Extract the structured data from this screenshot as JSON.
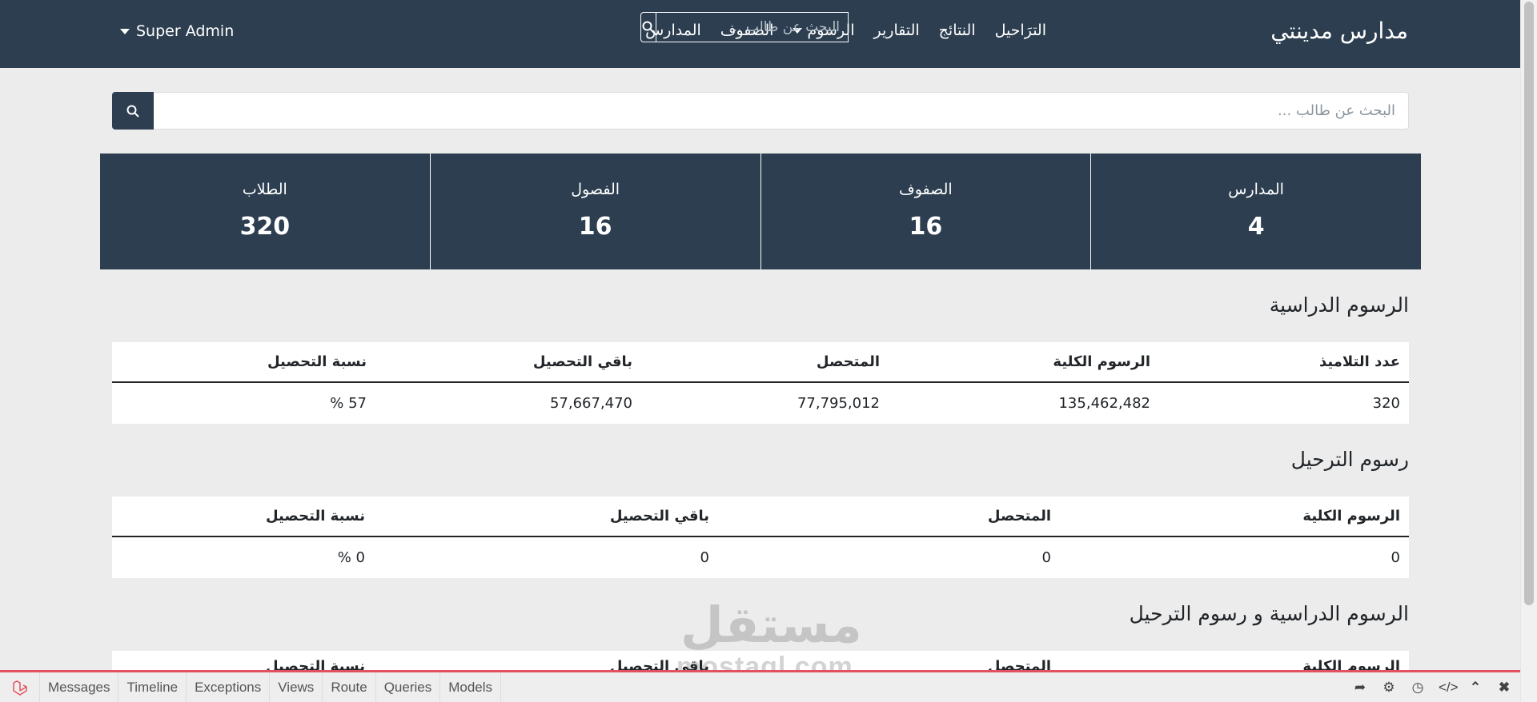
{
  "navbar": {
    "brand": "مدارس مدينتي",
    "links": [
      {
        "label": "المدارس",
        "dropdown": false
      },
      {
        "label": "الصفوف",
        "dropdown": false
      },
      {
        "label": "الرسوم",
        "dropdown": true
      },
      {
        "label": "التقارير",
        "dropdown": false
      },
      {
        "label": "النتائج",
        "dropdown": false
      },
      {
        "label": "الترَاحيل",
        "dropdown": false
      }
    ],
    "search_placeholder": "البحث عن طالب ...",
    "user": "Super Admin"
  },
  "main_search": {
    "placeholder": "البحث عن طالب ..."
  },
  "stats": [
    {
      "label": "المدارس",
      "value": "4"
    },
    {
      "label": "الصفوف",
      "value": "16"
    },
    {
      "label": "الفصول",
      "value": "16"
    },
    {
      "label": "الطلاب",
      "value": "320"
    }
  ],
  "fees": {
    "title": "الرسوم الدراسية",
    "headers": [
      "عدد التلاميذ",
      "الرسوم الكلية",
      "المتحصل",
      "باقي التحصيل",
      "نسبة التحصيل"
    ],
    "row": [
      "320",
      "135,462,482",
      "77,795,012",
      "57,667,470",
      "57 %"
    ]
  },
  "transfer": {
    "title": "رسوم الترحيل",
    "headers": [
      "الرسوم الكلية",
      "المتحصل",
      "باقي التحصيل",
      "نسبة التحصيل"
    ],
    "row": [
      "0",
      "0",
      "0",
      "0 %"
    ]
  },
  "combined": {
    "title": "الرسوم الدراسية و رسوم الترحيل",
    "headers": [
      "الرسوم الكلية",
      "المتحصل",
      "باقي التحصيل",
      "نسبة التحصيل"
    ]
  },
  "debugbar": {
    "tabs": [
      "Messages",
      "Timeline",
      "Exceptions",
      "Views",
      "Route",
      "Queries",
      "Models"
    ]
  },
  "watermark": {
    "ar": "مستقل",
    "en": "mostaql.com"
  },
  "colors": {
    "primary": "#2c3e50",
    "background": "#ececec",
    "debug_accent": "#e3505f"
  }
}
